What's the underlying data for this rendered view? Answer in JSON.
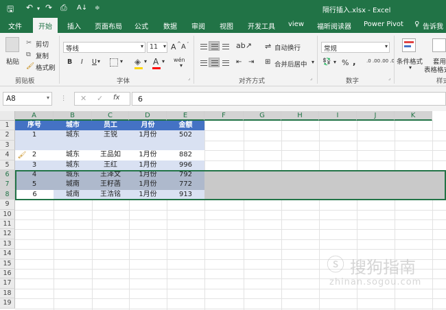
{
  "window": {
    "title": "隔行插入.xlsx  -  Excel"
  },
  "tabs": [
    {
      "label": "文件"
    },
    {
      "label": "开始"
    },
    {
      "label": "插入"
    },
    {
      "label": "页面布局"
    },
    {
      "label": "公式"
    },
    {
      "label": "数据"
    },
    {
      "label": "审阅"
    },
    {
      "label": "视图"
    },
    {
      "label": "开发工具"
    },
    {
      "label": "view"
    },
    {
      "label": "福昕阅读器"
    },
    {
      "label": "Power Pivot"
    },
    {
      "label": "告诉我"
    }
  ],
  "ribbon": {
    "clipboard": {
      "paste": "粘贴",
      "cut": "剪切",
      "copy": "复制",
      "format_painter": "格式刷",
      "group": "剪贴板"
    },
    "font": {
      "name": "等线",
      "size": "11",
      "grow": "A",
      "shrink": "A",
      "bold": "B",
      "italic": "I",
      "underline": "U",
      "group": "字体",
      "phonetic": "wén",
      "fill_letter": "A",
      "font_color_letter": "A"
    },
    "alignment": {
      "wrap": "自动换行",
      "merge": "合并后居中",
      "group": "对齐方式"
    },
    "number": {
      "format": "常规",
      "group": "数字",
      "percent": "%",
      "comma": ",",
      "inc": ".0 .00",
      "dec": ".00 .0"
    },
    "styles": {
      "conditional": "条件格式",
      "table1": "套用",
      "table2": "表格格式",
      "group": "样式"
    },
    "colors": {
      "accent": "#217346",
      "fill_highlight": "#ffd600",
      "font_red": "#ff0000"
    }
  },
  "formula_bar": {
    "cell_ref": "A8",
    "value": "6",
    "cancel": "✕",
    "enter": "✓",
    "fx": "fx"
  },
  "grid": {
    "columns": [
      "A",
      "B",
      "C",
      "D",
      "E",
      "F",
      "G",
      "H",
      "I",
      "J",
      "K"
    ],
    "rows": [
      "1",
      "2",
      "3",
      "4",
      "5",
      "6",
      "7",
      "8",
      "9",
      "10",
      "11",
      "12",
      "13",
      "14",
      "15",
      "16",
      "17",
      "18",
      "19"
    ],
    "header": [
      "序号",
      "城市",
      "员工",
      "月份",
      "金额"
    ],
    "data": [
      [
        "1",
        "城东",
        "王锐",
        "1月份",
        "502"
      ],
      [
        "",
        "",
        "",
        "",
        ""
      ],
      [
        "2",
        "城东",
        "王品如",
        "1月份",
        "882"
      ],
      [
        "3",
        "城东",
        "王红",
        "1月份",
        "996"
      ],
      [
        "4",
        "城东",
        "王泽文",
        "1月份",
        "792"
      ],
      [
        "5",
        "城南",
        "王籽菡",
        "1月份",
        "772"
      ],
      [
        "6",
        "城南",
        "王浩铭",
        "1月份",
        "913"
      ]
    ],
    "colors": {
      "header_fill": "#4472c4",
      "band_light": "#d9e1f2",
      "band_white": "#ffffff",
      "sel_gray": "#c9c9c9",
      "band_sel": "#aeb9cc"
    }
  },
  "watermark": {
    "cn": "搜狗指南",
    "en": "zhinan.sogou.com"
  }
}
